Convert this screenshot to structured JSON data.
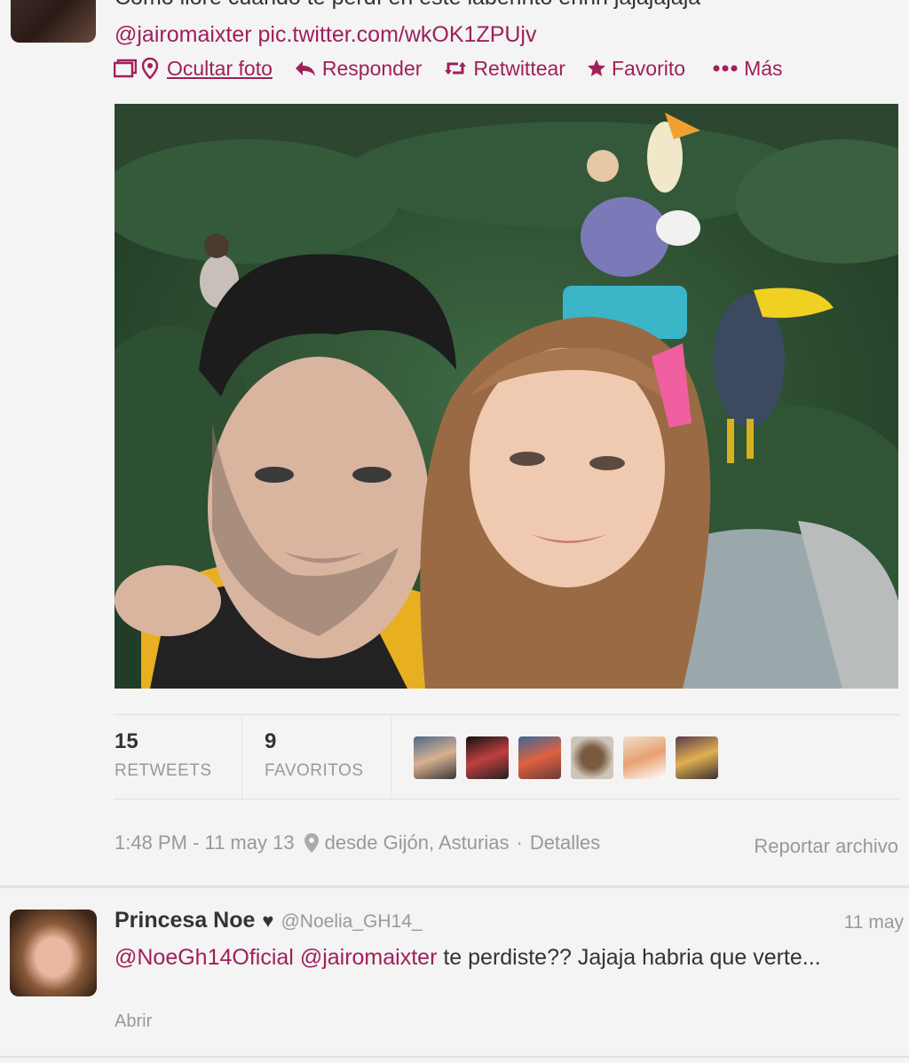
{
  "tweet": {
    "text_partial": "Como lloré cuando te perdí en este laberinto ehhh jajajajaja",
    "mention": "@jairomaixter",
    "pic_link": "pic.twitter.com/wkOK1ZPUjv"
  },
  "actions": {
    "hide_photo": "Ocultar foto",
    "reply": "Responder",
    "retweet": "Retwittear",
    "favorite": "Favorito",
    "more": "Más"
  },
  "stats": {
    "retweets_count": "15",
    "retweets_label": "RETWEETS",
    "favorites_count": "9",
    "favorites_label": "FAVORITOS"
  },
  "meta": {
    "time": "1:48 PM - 11 may 13",
    "location": "desde Gijón, Asturias",
    "sep": "·",
    "details": "Detalles",
    "report": "Reportar archivo"
  },
  "reply": {
    "name": "Princesa Noe",
    "heart": "♥",
    "handle": "@Noelia_GH14_",
    "date": "11 may",
    "mention1": "@NoeGh14Oficial",
    "mention2": "@jairomaixter",
    "text": " te perdiste?? Jajaja habria que verte...",
    "open": "Abrir"
  },
  "icons": [
    "photo-icon",
    "location-pin-icon",
    "reply-arrow-icon",
    "retweet-icon",
    "star-icon",
    "more-dots-icon"
  ],
  "colors": {
    "link": "#a0205a",
    "muted": "#999999",
    "background": "#f4f4f4"
  }
}
